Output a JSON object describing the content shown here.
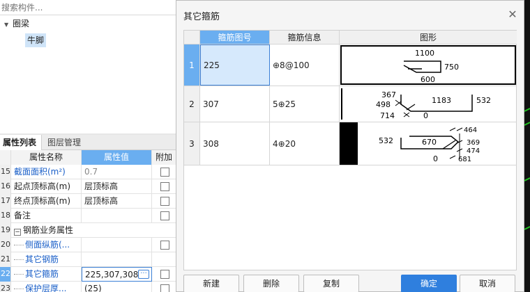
{
  "search": {
    "placeholder": "搜索构件..."
  },
  "tree": {
    "root": "圈梁",
    "child": "牛脚"
  },
  "tabs": {
    "properties": "属性列表",
    "layers": "图层管理"
  },
  "props": {
    "headers": {
      "name": "属性名称",
      "value": "属性值",
      "add": "附加"
    },
    "rows": [
      {
        "num": "15",
        "name": "截面面积(m²)",
        "value": "0.7"
      },
      {
        "num": "16",
        "name": "起点顶标高(m)",
        "value": "层顶标高"
      },
      {
        "num": "17",
        "name": "终点顶标高(m)",
        "value": "层顶标高"
      },
      {
        "num": "18",
        "name": "备注",
        "value": ""
      },
      {
        "num": "19",
        "name": "钢筋业务属性",
        "value": ""
      },
      {
        "num": "20",
        "name": "侧面纵筋(...",
        "value": ""
      },
      {
        "num": "21",
        "name": "其它钢筋",
        "value": ""
      },
      {
        "num": "22",
        "name": "其它箍筋",
        "value": "225,307,308"
      },
      {
        "num": "23",
        "name": "保护层厚...",
        "value": "(25)"
      }
    ],
    "collapse_symbol": "−",
    "ellipsis": "···"
  },
  "dialog": {
    "title": "其它箍筋",
    "close_symbol": "✕",
    "headers": {
      "code": "箍筋图号",
      "info": "箍筋信息",
      "shape": "图形"
    },
    "rows": [
      {
        "num": "1",
        "code": "225",
        "info": "⊕8@100",
        "dims": [
          "1100",
          "750",
          "600"
        ]
      },
      {
        "num": "2",
        "code": "307",
        "info": "5⊕25",
        "dims": [
          "367",
          "498",
          "714",
          "0",
          "1183",
          "532"
        ]
      },
      {
        "num": "3",
        "code": "308",
        "info": "4⊕20",
        "dims": [
          "532",
          "670",
          "0",
          "464",
          "369",
          "474",
          "681"
        ]
      }
    ],
    "buttons": {
      "new": "新建",
      "delete": "删除",
      "copy": "复制",
      "ok": "确定",
      "cancel": "取消"
    }
  }
}
